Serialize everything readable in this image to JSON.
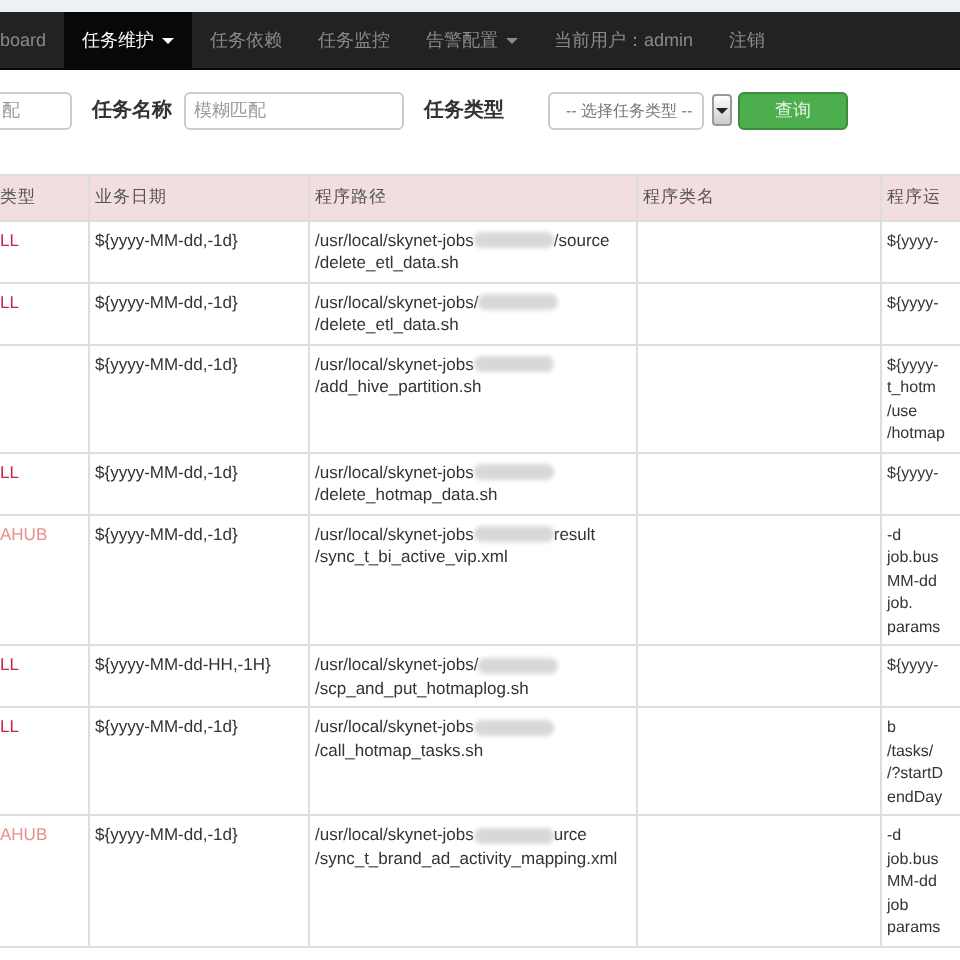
{
  "navbar": {
    "items": [
      {
        "label": "board",
        "selected": false,
        "has_caret": false
      },
      {
        "label": "任务维护",
        "selected": true,
        "has_caret": true
      },
      {
        "label": "任务依赖",
        "selected": false,
        "has_caret": false
      },
      {
        "label": "任务监控",
        "selected": false,
        "has_caret": false
      },
      {
        "label": "告警配置",
        "selected": false,
        "has_caret": true
      },
      {
        "label": "当前用户：admin",
        "selected": false,
        "has_caret": false
      },
      {
        "label": "注销",
        "selected": false,
        "has_caret": false
      }
    ]
  },
  "filter": {
    "first_field": {
      "placeholder": "配"
    },
    "name_label": "任务名称",
    "name_field": {
      "placeholder": "模糊匹配"
    },
    "type_label": "任务类型",
    "type_select": {
      "value": "-- 选择任务类型 --"
    },
    "search_button": "查询"
  },
  "table": {
    "columns": [
      "类型",
      "业务日期",
      "程序路径",
      "程序类名",
      "程序运"
    ],
    "rows": [
      {
        "type": {
          "text": "LL",
          "color": "#c7254e"
        },
        "date": "${yyyy-MM-dd,-1d}",
        "path": [
          [
            {
              "kind": "text",
              "text": "/usr/local/skynet-jobs"
            },
            {
              "kind": "blur"
            },
            {
              "kind": "text",
              "text": "/source"
            }
          ],
          [
            {
              "kind": "text",
              "text": "/delete_etl_data.sh"
            }
          ]
        ],
        "params": [
          "${yyyy-"
        ]
      },
      {
        "type": {
          "text": "LL",
          "color": "#c7254e"
        },
        "date": "${yyyy-MM-dd,-1d}",
        "path": [
          [
            {
              "kind": "text",
              "text": "/usr/local/skynet-jobs/"
            },
            {
              "kind": "blur"
            }
          ],
          [
            {
              "kind": "text",
              "text": "/delete_etl_data.sh"
            }
          ]
        ],
        "params": [
          "${yyyy-"
        ]
      },
      {
        "date": "${yyyy-MM-dd,-1d}",
        "path": [
          [
            {
              "kind": "text",
              "text": "/usr/local/skynet-jobs"
            },
            {
              "kind": "blur"
            }
          ],
          [
            {
              "kind": "text",
              "text": "/add_hive_partition.sh"
            }
          ]
        ],
        "params": [
          "${yyyy-",
          "t_hotm",
          "/use",
          "/hotmap"
        ]
      },
      {
        "type": {
          "text": "LL",
          "color": "#c7254e"
        },
        "date": "${yyyy-MM-dd,-1d}",
        "path": [
          [
            {
              "kind": "text",
              "text": "/usr/local/skynet-jobs"
            },
            {
              "kind": "blur"
            }
          ],
          [
            {
              "kind": "text",
              "text": "/delete_hotmap_data.sh"
            }
          ]
        ],
        "params": [
          "${yyyy-"
        ]
      },
      {
        "type": {
          "text": "AHUB",
          "color": "#e8908a"
        },
        "date": "${yyyy-MM-dd,-1d}",
        "path": [
          [
            {
              "kind": "text",
              "text": "/usr/local/skynet-jobs"
            },
            {
              "kind": "blur"
            },
            {
              "kind": "text",
              "text": "result"
            }
          ],
          [
            {
              "kind": "text",
              "text": "/sync_t_bi_active_vip.xml"
            }
          ]
        ],
        "params": [
          "-d",
          "job.bus",
          "MM-dd",
          "job.",
          "params"
        ]
      },
      {
        "type": {
          "text": "LL",
          "color": "#c7254e"
        },
        "date": "${yyyy-MM-dd-HH,-1H}",
        "path": [
          [
            {
              "kind": "text",
              "text": "/usr/local/skynet-jobs/"
            },
            {
              "kind": "blur"
            }
          ],
          [
            {
              "kind": "text",
              "text": "/scp_and_put_hotmaplog.sh"
            }
          ]
        ],
        "params": [
          "${yyyy-"
        ]
      },
      {
        "type": {
          "text": "LL",
          "color": "#c7254e"
        },
        "date": "${yyyy-MM-dd,-1d}",
        "path": [
          [
            {
              "kind": "text",
              "text": "/usr/local/skynet-jobs"
            },
            {
              "kind": "blur"
            }
          ],
          [
            {
              "kind": "text",
              "text": "/call_hotmap_tasks.sh"
            }
          ]
        ],
        "params": [
          "b",
          "/tasks/",
          "/?startD",
          "endDay"
        ]
      },
      {
        "type": {
          "text": "AHUB",
          "color": "#e8908a"
        },
        "date": "${yyyy-MM-dd,-1d}",
        "path": [
          [
            {
              "kind": "text",
              "text": "/usr/local/skynet-jobs"
            },
            {
              "kind": "blur"
            },
            {
              "kind": "text",
              "text": "urce"
            }
          ],
          [
            {
              "kind": "text",
              "text": "/sync_t_brand_ad_activity_mapping.xml"
            }
          ]
        ],
        "params": [
          "-d",
          "job.bus",
          "MM-dd",
          "job",
          "params"
        ]
      }
    ]
  }
}
